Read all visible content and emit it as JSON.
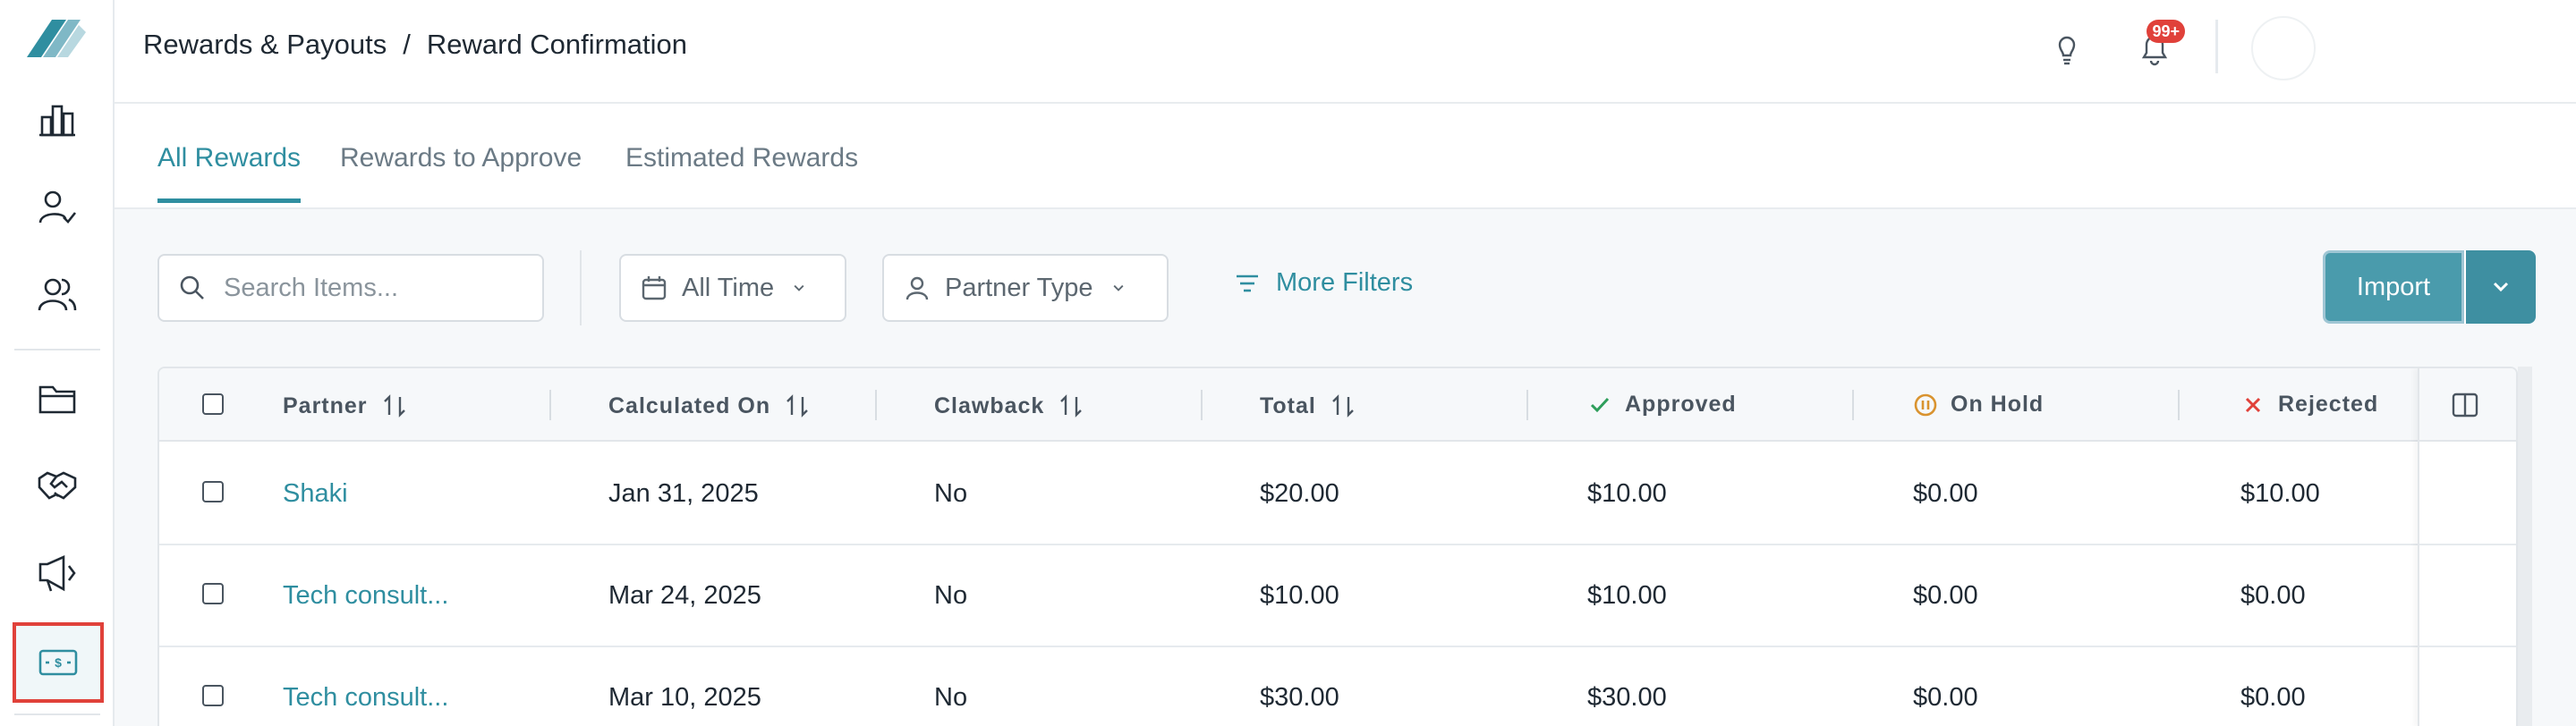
{
  "header": {
    "breadcrumb": [
      "Rewards & Payouts",
      "/",
      "Reward Confirmation"
    ],
    "notifications_badge": "99+"
  },
  "tabs": [
    {
      "label": "All Rewards",
      "active": true
    },
    {
      "label": "Rewards to Approve",
      "active": false
    },
    {
      "label": "Estimated Rewards",
      "active": false
    }
  ],
  "toolbar": {
    "search_placeholder": "Search Items...",
    "time_filter": "All Time",
    "partner_type_filter": "Partner Type",
    "more_filters": "More Filters",
    "import_label": "Import"
  },
  "table": {
    "columns": [
      "Partner",
      "Calculated On",
      "Clawback",
      "Total",
      "Approved",
      "On Hold",
      "Rejected"
    ],
    "rows": [
      {
        "partner": "Shaki",
        "calculated_on": "Jan 31, 2025",
        "clawback": "No",
        "total": "$20.00",
        "approved": "$10.00",
        "on_hold": "$0.00",
        "rejected": "$10.00"
      },
      {
        "partner": "Tech consult...",
        "calculated_on": "Mar 24, 2025",
        "clawback": "No",
        "total": "$10.00",
        "approved": "$10.00",
        "on_hold": "$0.00",
        "rejected": "$0.00"
      },
      {
        "partner": "Tech consult...",
        "calculated_on": "Mar 10, 2025",
        "clawback": "No",
        "total": "$30.00",
        "approved": "$30.00",
        "on_hold": "$0.00",
        "rejected": "$0.00"
      }
    ]
  },
  "sidebar": {
    "items": [
      "analytics-icon",
      "partner-approval-icon",
      "partners-icon",
      "folder-icon",
      "handshake-icon",
      "megaphone-icon",
      "rewards-icon"
    ],
    "active_item": "rewards-icon"
  },
  "colors": {
    "accent": "#2f8ea0",
    "import_button": "#4a9bac",
    "badge": "#e0413a",
    "approved": "#2e9e5b",
    "on_hold": "#d9932f",
    "rejected": "#e0413a",
    "active_highlight": "#e0413a"
  }
}
